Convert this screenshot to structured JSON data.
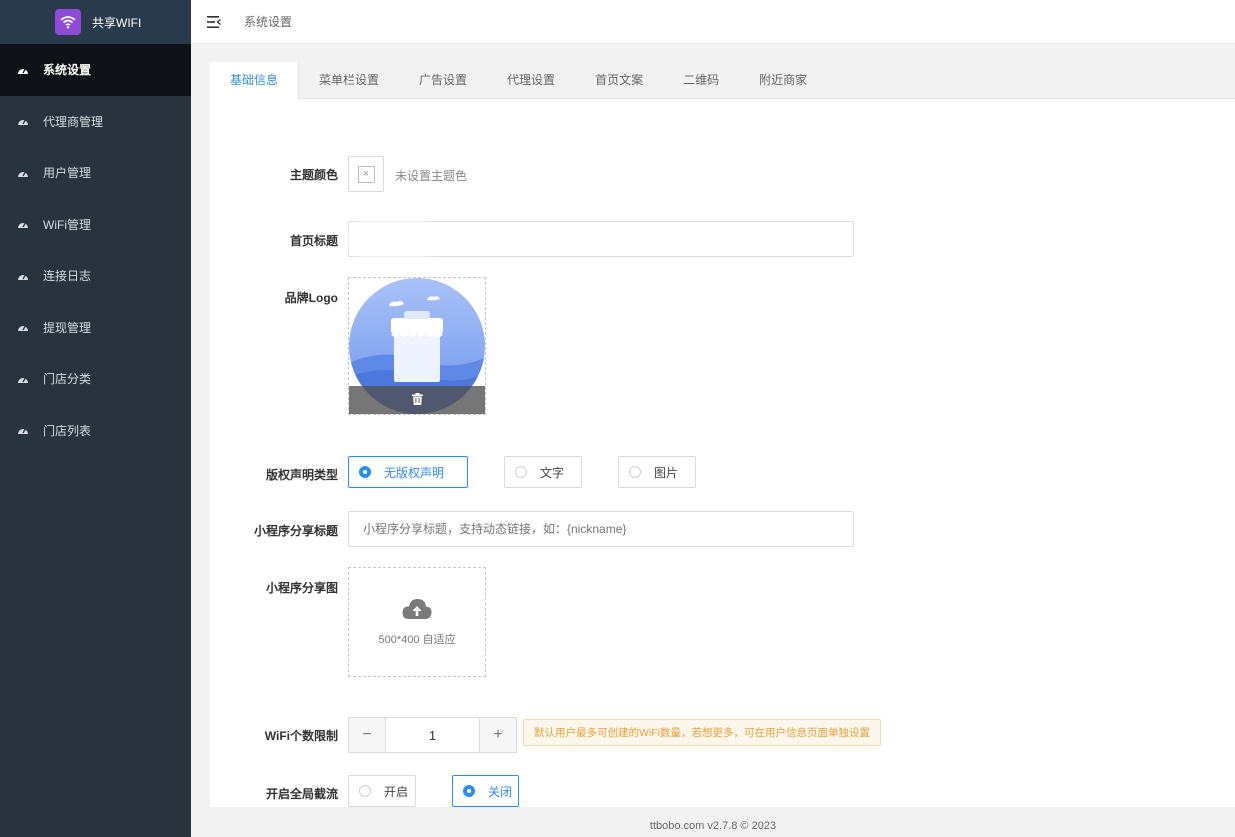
{
  "brand": {
    "name": "共享WIFI",
    "logo_icon": "wifi-icon",
    "logo_color": "#8f4bd8"
  },
  "header": {
    "title": "系统设置",
    "menu_icon": "menu-fold-icon"
  },
  "sidebar": {
    "items": [
      {
        "label": "系统设置",
        "icon": "dashboard-icon",
        "active": true
      },
      {
        "label": "代理商管理",
        "icon": "dashboard-icon"
      },
      {
        "label": "用户管理",
        "icon": "dashboard-icon"
      },
      {
        "label": "WiFi管理",
        "icon": "dashboard-icon"
      },
      {
        "label": "连接日志",
        "icon": "dashboard-icon"
      },
      {
        "label": "提现管理",
        "icon": "dashboard-icon"
      },
      {
        "label": "门店分类",
        "icon": "dashboard-icon"
      },
      {
        "label": "门店列表",
        "icon": "dashboard-icon"
      }
    ]
  },
  "tabs": [
    {
      "label": "基础信息",
      "active": true
    },
    {
      "label": "菜单栏设置"
    },
    {
      "label": "广告设置"
    },
    {
      "label": "代理设置"
    },
    {
      "label": "首页文案"
    },
    {
      "label": "二维码"
    },
    {
      "label": "附近商家"
    }
  ],
  "form": {
    "theme_color": {
      "label": "主题颜色",
      "swatch_symbol": "×",
      "status": "未设置主题色"
    },
    "home_title": {
      "label": "首页标题",
      "value": ""
    },
    "brand_logo": {
      "label": "品牌Logo",
      "delete_icon": "trash-icon"
    },
    "copyright_type": {
      "label": "版权声明类型",
      "options": [
        "无版权声明",
        "文字",
        "图片"
      ],
      "selected": "无版权声明"
    },
    "share_title": {
      "label": "小程序分享标题",
      "placeholder": "小程序分享标题，支持动态链接，如：{nickname}"
    },
    "share_image": {
      "label": "小程序分享图",
      "hint": "500*400 自适应",
      "upload_icon": "cloud-upload-icon"
    },
    "wifi_limit": {
      "label": "WiFi个数限制",
      "minus": "−",
      "value": "1",
      "plus": "+",
      "notice": "默认用户最多可创建的WiFi数量，若想更多，可在用户信息页面单独设置"
    },
    "global_intercept": {
      "label": "开启全局截流",
      "options": [
        "开启",
        "关闭"
      ],
      "selected": "关闭"
    }
  },
  "footer": {
    "text": "ttbobo.com v2.7.8 © 2023"
  },
  "colors": {
    "sidebar_bg": "#28333e",
    "active_nav_bg": "#0e1217",
    "accent": "#2d8cf0"
  }
}
